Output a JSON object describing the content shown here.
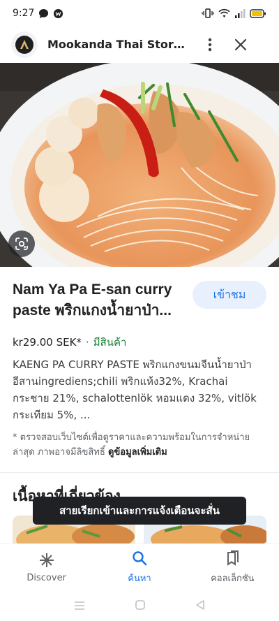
{
  "status_bar": {
    "time": "9:27"
  },
  "header": {
    "store_name": "Mookanda Thai Store มุ..."
  },
  "product": {
    "title": "Nam Ya Pa E-san curry paste พริกแกงน้ำยาป่า...",
    "visit_button": "เข้าชม",
    "price": "kr29.00 SEK*",
    "separator": "·",
    "stock_status": "มีสินค้า",
    "description": "KAENG PA CURRY PASTE พริกแกงขนมจีนน้ำยาป่าอีสานingrediens;chili พริกแห้ง32%, Krachai กระชาย 21%, schalottenlök หอมแดง 32%, vitlök กระเทียม 5%, ...",
    "disclaimer": "* ตรวจสอบเว็บไซต์เพื่อดูราคาและความพร้อมในการจำหน่ายล่าสุด ภาพอาจมีลิขสิทธิ์",
    "more_info": "ดูข้อมูลเพิ่มเติม"
  },
  "related": {
    "title": "เนื้อหาที่เกี่ยวข้อง"
  },
  "toast": {
    "message": "สายเรียกเข้าและการแจ้งเตือนจะสั่น"
  },
  "bottom_nav": {
    "items": [
      {
        "label": "Discover",
        "icon": "asterisk-icon"
      },
      {
        "label": "ค้นหา",
        "icon": "search-icon",
        "active": true
      },
      {
        "label": "คอลเล็กชัน",
        "icon": "collections-icon"
      }
    ]
  },
  "colors": {
    "accent": "#1a73e8",
    "stock_green": "#188038",
    "toast_bg": "#202124"
  }
}
